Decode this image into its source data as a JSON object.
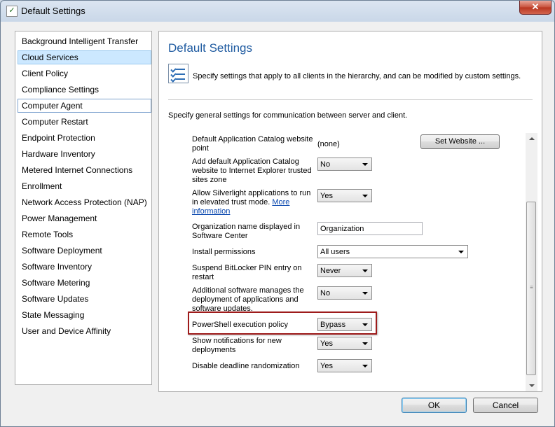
{
  "window": {
    "title": "Default Settings",
    "close_glyph": "✕"
  },
  "nav": {
    "items": [
      {
        "label": "Background Intelligent Transfer"
      },
      {
        "label": "Cloud Services"
      },
      {
        "label": "Client Policy"
      },
      {
        "label": "Compliance Settings"
      },
      {
        "label": "Computer Agent"
      },
      {
        "label": "Computer Restart"
      },
      {
        "label": "Endpoint Protection"
      },
      {
        "label": "Hardware Inventory"
      },
      {
        "label": "Metered Internet Connections"
      },
      {
        "label": "Enrollment"
      },
      {
        "label": "Network Access Protection (NAP)"
      },
      {
        "label": "Power Management"
      },
      {
        "label": "Remote Tools"
      },
      {
        "label": "Software Deployment"
      },
      {
        "label": "Software Inventory"
      },
      {
        "label": "Software Metering"
      },
      {
        "label": "Software Updates"
      },
      {
        "label": "State Messaging"
      },
      {
        "label": "User and Device Affinity"
      }
    ],
    "selected": "Cloud Services",
    "focused": "Computer Agent"
  },
  "panel": {
    "title": "Default Settings",
    "description": "Specify settings that apply to all clients in the hierarchy, and can be modified by custom settings.",
    "subheading": "Specify general settings for communication between server and client.",
    "icon": "checklist-icon"
  },
  "settings": {
    "catalog_point": {
      "label": "Default Application Catalog website point",
      "value": "(none)",
      "button": "Set Website ..."
    },
    "add_catalog": {
      "label": "Add default Application Catalog website to Internet Explorer trusted sites zone",
      "value": "No"
    },
    "silverlight": {
      "label": "Allow Silverlight applications to run in elevated trust mode.",
      "link": "More information",
      "value": "Yes"
    },
    "org_name": {
      "label": "Organization name displayed in Software Center",
      "value": "Organization"
    },
    "install_perms": {
      "label": "Install permissions",
      "value": "All users"
    },
    "bitlocker": {
      "label": "Suspend BitLocker PIN entry on restart",
      "value": "Never"
    },
    "addl_software": {
      "label": "Additional software manages the deployment of applications and software updates.",
      "value": "No"
    },
    "powershell": {
      "label": "PowerShell execution policy",
      "value": "Bypass"
    },
    "notifications": {
      "label": "Show notifications for new deployments",
      "value": "Yes"
    },
    "deadline": {
      "label": "Disable deadline randomization",
      "value": "Yes"
    }
  },
  "footer": {
    "ok": "OK",
    "cancel": "Cancel"
  },
  "colors": {
    "accent_title": "#1e5aa0",
    "highlight_border": "#9e1b1b",
    "selection": "#cce8ff"
  }
}
